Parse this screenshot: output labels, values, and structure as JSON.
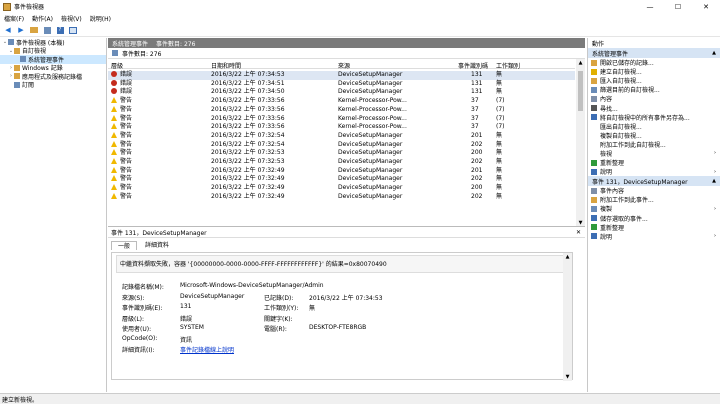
{
  "window": {
    "title": "事件檢視器",
    "minimize": "—",
    "maximize": "☐",
    "close": "✕"
  },
  "menu": [
    "檔案(F)",
    "動作(A)",
    "檢視(V)",
    "說明(H)"
  ],
  "toolbar_icons": [
    "back-arrow-icon",
    "forward-arrow-icon",
    "folder-icon",
    "properties-icon",
    "help-icon",
    "panel-icon"
  ],
  "tree": [
    {
      "label": "事件檢視器 (本機)",
      "indent": 0,
      "expander": "⌄",
      "color": "#6a8cb8"
    },
    {
      "label": "自訂檢視",
      "indent": 1,
      "expander": "⌄",
      "color": "#d9a441"
    },
    {
      "label": "系統管理事件",
      "indent": 2,
      "expander": "",
      "color": "#6a8cb8",
      "selected": true
    },
    {
      "label": "Windows 記錄",
      "indent": 1,
      "expander": "›",
      "color": "#d9a441"
    },
    {
      "label": "應用程式及服務記錄檔",
      "indent": 1,
      "expander": "›",
      "color": "#d9a441"
    },
    {
      "label": "訂閱",
      "indent": 1,
      "expander": "",
      "color": "#6a8cb8"
    }
  ],
  "center": {
    "header": {
      "title": "系統管理事件",
      "count": "事件數目: 276"
    },
    "filter": "事件數目: 276",
    "columns": [
      "層級",
      "日期和時間",
      "來源",
      "事件識別碼",
      "工作類別"
    ],
    "rows": [
      {
        "level": "錯誤",
        "type": "err",
        "dt": "2016/3/22 上午 07:34:53",
        "src": "DeviceSetupManager",
        "id": "131",
        "cat": "無",
        "selected": true
      },
      {
        "level": "錯誤",
        "type": "err",
        "dt": "2016/3/22 上午 07:34:51",
        "src": "DeviceSetupManager",
        "id": "131",
        "cat": "無"
      },
      {
        "level": "錯誤",
        "type": "err",
        "dt": "2016/3/22 上午 07:34:50",
        "src": "DeviceSetupManager",
        "id": "131",
        "cat": "無"
      },
      {
        "level": "警告",
        "type": "warn",
        "dt": "2016/3/22 上午 07:33:56",
        "src": "Kernel-Processor-Pow...",
        "id": "37",
        "cat": "(7)"
      },
      {
        "level": "警告",
        "type": "warn",
        "dt": "2016/3/22 上午 07:33:56",
        "src": "Kernel-Processor-Pow...",
        "id": "37",
        "cat": "(7)"
      },
      {
        "level": "警告",
        "type": "warn",
        "dt": "2016/3/22 上午 07:33:56",
        "src": "Kernel-Processor-Pow...",
        "id": "37",
        "cat": "(7)"
      },
      {
        "level": "警告",
        "type": "warn",
        "dt": "2016/3/22 上午 07:33:56",
        "src": "Kernel-Processor-Pow...",
        "id": "37",
        "cat": "(7)"
      },
      {
        "level": "警告",
        "type": "warn",
        "dt": "2016/3/22 上午 07:32:54",
        "src": "DeviceSetupManager",
        "id": "201",
        "cat": "無"
      },
      {
        "level": "警告",
        "type": "warn",
        "dt": "2016/3/22 上午 07:32:54",
        "src": "DeviceSetupManager",
        "id": "202",
        "cat": "無"
      },
      {
        "level": "警告",
        "type": "warn",
        "dt": "2016/3/22 上午 07:32:53",
        "src": "DeviceSetupManager",
        "id": "200",
        "cat": "無"
      },
      {
        "level": "警告",
        "type": "warn",
        "dt": "2016/3/22 上午 07:32:53",
        "src": "DeviceSetupManager",
        "id": "202",
        "cat": "無"
      },
      {
        "level": "警告",
        "type": "warn",
        "dt": "2016/3/22 上午 07:32:49",
        "src": "DeviceSetupManager",
        "id": "201",
        "cat": "無"
      },
      {
        "level": "警告",
        "type": "warn",
        "dt": "2016/3/22 上午 07:32:49",
        "src": "DeviceSetupManager",
        "id": "202",
        "cat": "無"
      },
      {
        "level": "警告",
        "type": "warn",
        "dt": "2016/3/22 上午 07:32:49",
        "src": "DeviceSetupManager",
        "id": "200",
        "cat": "無"
      },
      {
        "level": "警告",
        "type": "warn",
        "dt": "2016/3/22 上午 07:32:49",
        "src": "DeviceSetupManager",
        "id": "202",
        "cat": "無"
      }
    ],
    "detail": {
      "title": "事件 131，DeviceSetupManager",
      "tabs": [
        "一般",
        "詳細資料"
      ],
      "message": "中繼資料擷取失敗，容器 '{00000000-0000-0000-FFFF-FFFFFFFFFFFF}' 的結果=0x80070490",
      "fields": [
        {
          "k": "記錄檔名稱(M):",
          "v": "Microsoft-Windows-DeviceSetupManager/Admin"
        },
        {
          "k": "來源(S):",
          "v": "DeviceSetupManager",
          "k2": "已記錄(D):",
          "v2": "2016/3/22 上午 07:34:53"
        },
        {
          "k": "事件識別碼(E):",
          "v": "131",
          "k2": "工作類別(Y):",
          "v2": "無"
        },
        {
          "k": "層級(L):",
          "v": "錯誤",
          "k2": "關鍵字(K):",
          "v2": ""
        },
        {
          "k": "使用者(U):",
          "v": "SYSTEM",
          "k2": "電腦(R):",
          "v2": "DESKTOP-FTE8RGB"
        },
        {
          "k": "OpCode(O):",
          "v": "資訊"
        },
        {
          "k": "詳細資訊(I):",
          "v": "事件記錄檔線上說明",
          "link": true
        }
      ]
    }
  },
  "actions": {
    "header": "動作",
    "section1": "系統管理事件",
    "items1": [
      {
        "label": "開啟已儲存的記錄...",
        "icon": "open-log-icon",
        "color": "#d9a441"
      },
      {
        "label": "建立自訂檢視...",
        "icon": "filter-icon",
        "color": "#e0b000"
      },
      {
        "label": "匯入自訂檢視...",
        "icon": "import-icon",
        "color": "#d9a441"
      },
      {
        "label": "篩選目前的自訂檢視...",
        "icon": "filter-icon",
        "color": "#6a8cb8"
      },
      {
        "label": "內容",
        "icon": "properties-icon",
        "color": "#7f8fa8"
      },
      {
        "label": "尋找...",
        "icon": "find-icon",
        "color": "#555555"
      },
      {
        "label": "將自訂檢視中的所有事件另存為...",
        "icon": "save-icon",
        "color": "#3c6eb4"
      },
      {
        "label": "匯出自訂檢視...",
        "icon": "",
        "color": ""
      },
      {
        "label": "複製自訂檢視...",
        "icon": "",
        "color": ""
      },
      {
        "label": "附加工作到此自訂檢視...",
        "icon": "",
        "color": ""
      },
      {
        "label": "檢視",
        "icon": "",
        "color": "",
        "arrow": "›"
      },
      {
        "label": "重新整理",
        "icon": "refresh-icon",
        "color": "#2f9a3b"
      },
      {
        "label": "說明",
        "icon": "help-icon",
        "color": "#3c6eb4",
        "arrow": "›"
      }
    ],
    "section2": "事件 131，DeviceSetupManager",
    "items2": [
      {
        "label": "事件內容",
        "icon": "event-properties-icon",
        "color": "#7f8fa8"
      },
      {
        "label": "附加工作到此事件...",
        "icon": "attach-task-icon",
        "color": "#d9a441"
      },
      {
        "label": "複製",
        "icon": "copy-icon",
        "color": "#6a8cb8",
        "arrow": "›"
      },
      {
        "label": "儲存選取的事件...",
        "icon": "save-icon",
        "color": "#3c6eb4"
      },
      {
        "label": "重新整理",
        "icon": "refresh-icon",
        "color": "#2f9a3b"
      },
      {
        "label": "說明",
        "icon": "help-icon",
        "color": "#3c6eb4",
        "arrow": "›"
      }
    ]
  },
  "status": "建立新檢視。"
}
